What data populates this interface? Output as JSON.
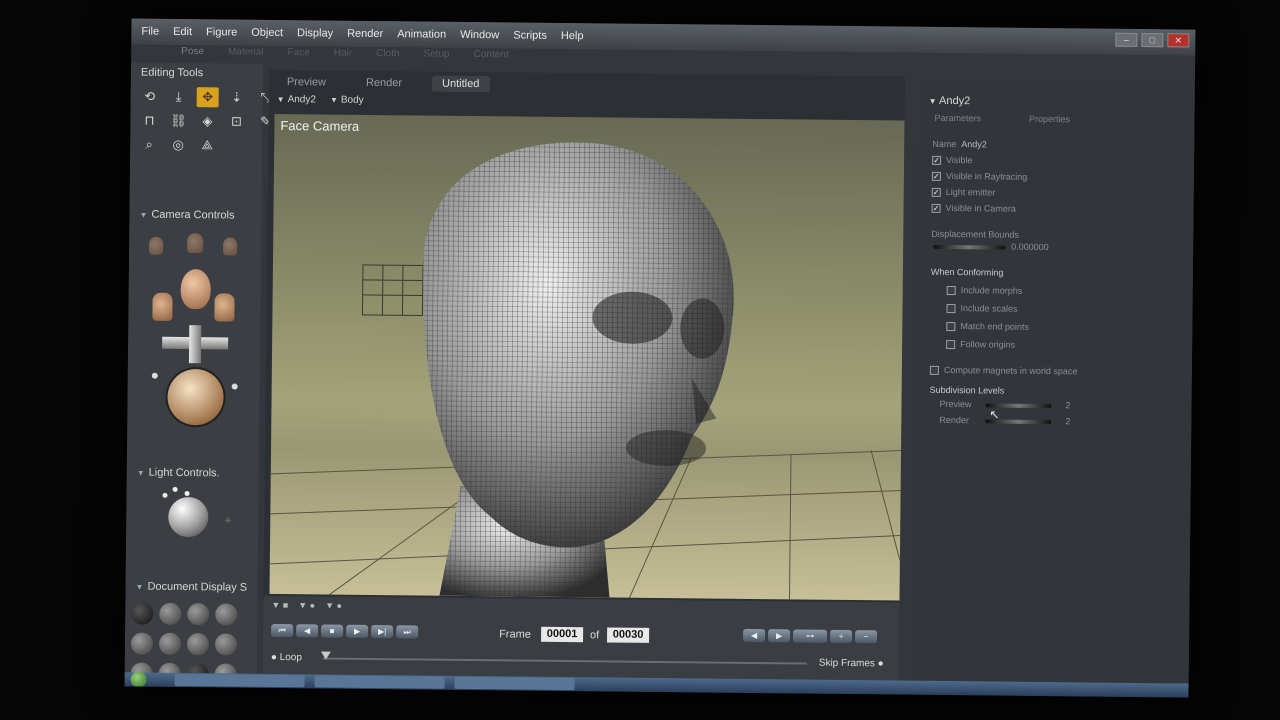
{
  "menubar": {
    "items": [
      "File",
      "Edit",
      "Figure",
      "Object",
      "Display",
      "Render",
      "Animation",
      "Window",
      "Scripts",
      "Help"
    ]
  },
  "rooms": {
    "tabs": [
      "Pose",
      "Material",
      "Face",
      "Hair",
      "Cloth",
      "Setup",
      "Content"
    ]
  },
  "left_panel": {
    "editing_tools_title": "Editing Tools",
    "camera_controls_title": "Camera Controls",
    "light_controls_title": "Light Controls.",
    "document_display_title": "Document Display S"
  },
  "document": {
    "tabs": [
      "Preview",
      "Render",
      "Untitled"
    ],
    "active_tab": "Untitled",
    "figure": "Andy2",
    "actor": "Body",
    "camera_label": "Face Camera"
  },
  "timeline": {
    "frame_label": "Frame",
    "current_frame": "00001",
    "of_label": "of",
    "total_frames": "00030",
    "loop_label": "Loop",
    "skip_frames_label": "Skip Frames"
  },
  "properties": {
    "title": "Andy2",
    "tabs": [
      "Parameters",
      "Properties"
    ],
    "name_label": "Name",
    "name_value": "Andy2",
    "checks": [
      {
        "label": "Visible",
        "checked": "✓"
      },
      {
        "label": "Visible in Raytracing",
        "checked": "✓"
      },
      {
        "label": "Light emitter",
        "checked": "✓"
      },
      {
        "label": "Visible in Camera",
        "checked": "✓"
      }
    ],
    "displacement_label": "Displacement Bounds",
    "displacement_value": "0.000000",
    "when_conforming_label": "When Conforming",
    "conform_options": [
      "Include morphs",
      "Include scales",
      "Match end points",
      "Follow origins"
    ],
    "compute_label": "Compute magnets in world space",
    "subdivision_label": "Subdivision Levels",
    "preview_label": "Preview",
    "preview_value": "2",
    "render_label": "Render",
    "render_value": "2"
  },
  "colors": {
    "accent_tool": "#d8a21c",
    "background": "#33363a"
  }
}
